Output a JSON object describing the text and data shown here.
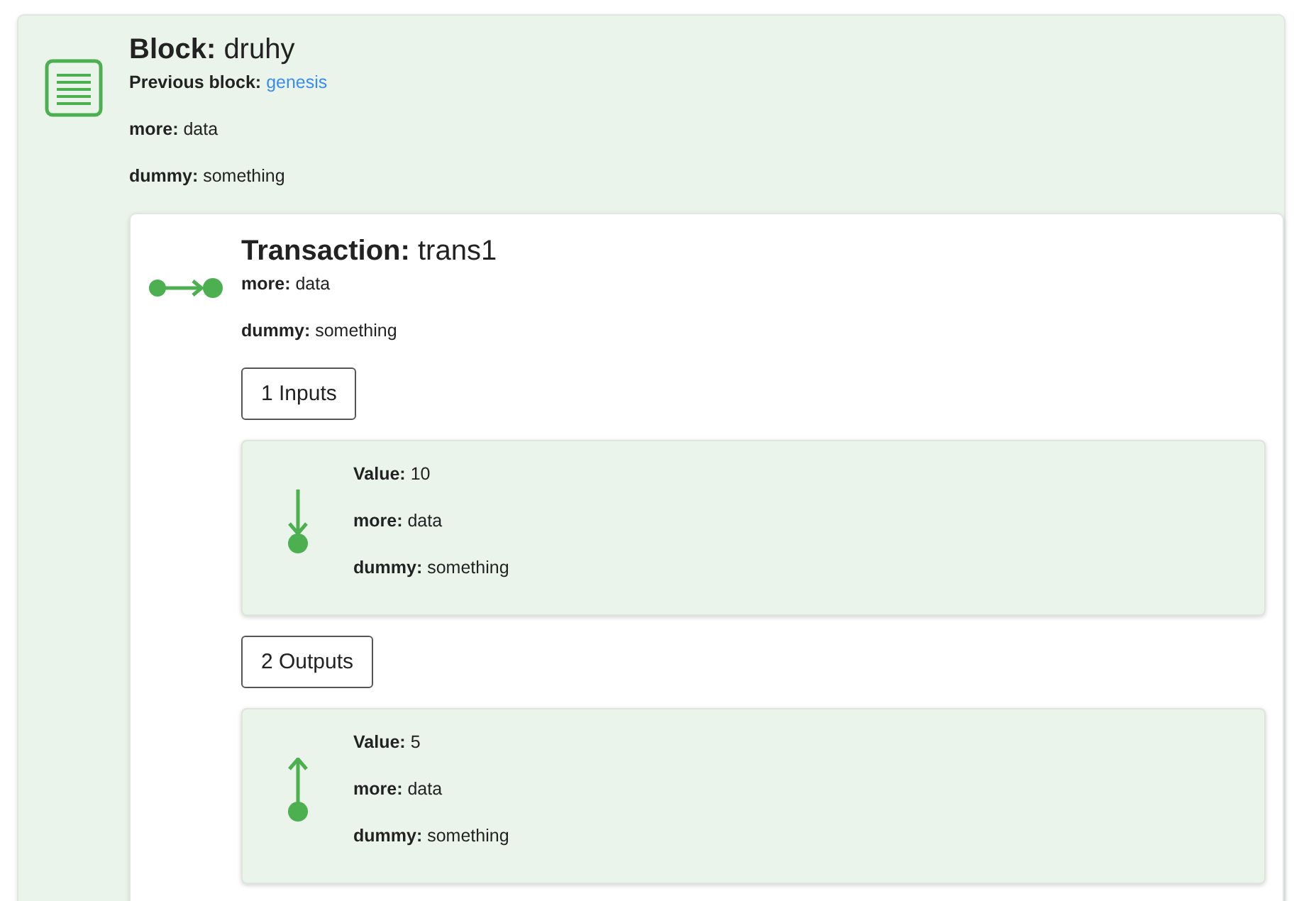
{
  "block": {
    "title_label": "Block:",
    "title_value": "druhy",
    "previous_label": "Previous block:",
    "previous_link": "genesis",
    "fields": [
      {
        "label": "more:",
        "value": "data"
      },
      {
        "label": "dummy:",
        "value": "something"
      }
    ],
    "transaction": {
      "title_label": "Transaction:",
      "title_value": "trans1",
      "fields": [
        {
          "label": "more:",
          "value": "data"
        },
        {
          "label": "dummy:",
          "value": "something"
        }
      ],
      "sections": [
        {
          "kind": "input",
          "button": "1 Inputs",
          "items": [
            {
              "fields": [
                {
                  "label": "Value:",
                  "value": "10"
                },
                {
                  "label": "more:",
                  "value": "data"
                },
                {
                  "label": "dummy:",
                  "value": "something"
                }
              ]
            }
          ]
        },
        {
          "kind": "output",
          "button": "2 Outputs",
          "items": [
            {
              "fields": [
                {
                  "label": "Value:",
                  "value": "5"
                },
                {
                  "label": "more:",
                  "value": "data"
                },
                {
                  "label": "dummy:",
                  "value": "something"
                }
              ]
            }
          ]
        }
      ]
    }
  }
}
